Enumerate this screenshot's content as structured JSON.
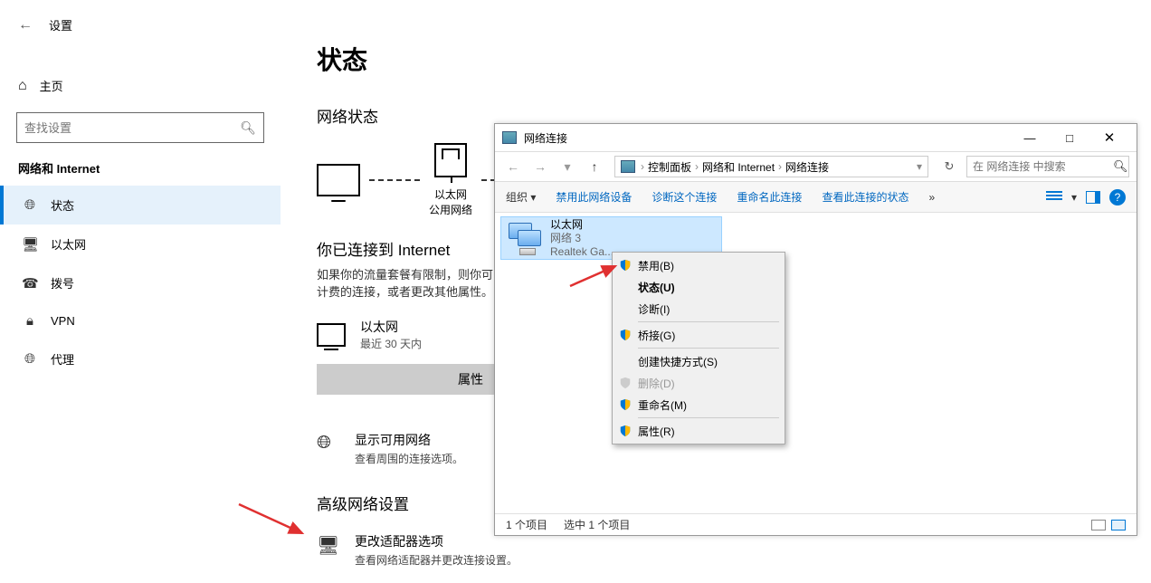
{
  "settings": {
    "window_title": "设置",
    "home_label": "主页",
    "search_placeholder": "查找设置",
    "section": "网络和 Internet",
    "sidebar": [
      {
        "label": "状态",
        "selected": true
      },
      {
        "label": "以太网",
        "selected": false
      },
      {
        "label": "拨号",
        "selected": false
      },
      {
        "label": "VPN",
        "selected": false
      },
      {
        "label": "代理",
        "selected": false
      }
    ],
    "main": {
      "title": "状态",
      "net_status_heading": "网络状态",
      "diagram": {
        "eth_label": "以太网",
        "eth_sub": "公用网络"
      },
      "connected_title": "你已连接到 Internet",
      "connected_desc": "如果你的流量套餐有限制，则你可以将此网络设置为按流量计费的连接，或者更改其他属性。",
      "eth_card": {
        "name": "以太网",
        "sub": "最近 30 天内"
      },
      "properties_button": "属性",
      "show_networks": {
        "title": "显示可用网络",
        "desc": "查看周围的连接选项。"
      },
      "advanced_heading": "高级网络设置",
      "adapter_options": {
        "title": "更改适配器选项",
        "desc": "查看网络适配器并更改连接设置。"
      }
    }
  },
  "nc": {
    "title": "网络连接",
    "breadcrumb": [
      "控制面板",
      "网络和 Internet",
      "网络连接"
    ],
    "search_placeholder": "在 网络连接 中搜索",
    "toolbar": {
      "organize": "组织",
      "disable": "禁用此网络设备",
      "diagnose": "诊断这个连接",
      "rename": "重命名此连接",
      "view_status": "查看此连接的状态",
      "overflow": "»"
    },
    "item": {
      "name": "以太网",
      "network": "网络 3",
      "adapter": "Realtek Ga..."
    },
    "status_bar": {
      "count": "1 个项目",
      "selected": "选中 1 个项目"
    }
  },
  "ctx": {
    "disable": "禁用(B)",
    "status": "状态(U)",
    "diagnose": "诊断(I)",
    "bridge": "桥接(G)",
    "shortcut": "创建快捷方式(S)",
    "delete": "删除(D)",
    "rename": "重命名(M)",
    "properties": "属性(R)"
  }
}
